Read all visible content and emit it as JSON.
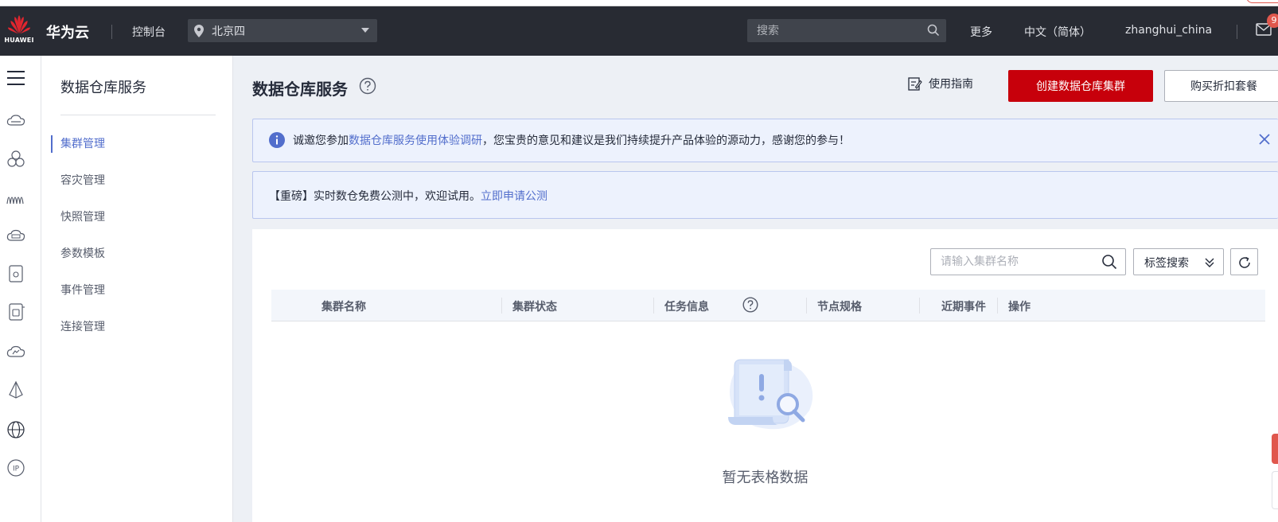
{
  "topbar": {
    "logo_text": "HUAWEI",
    "brand": "华为云",
    "console": "控制台",
    "region": "北京四",
    "search_placeholder": "搜索",
    "more": "更多",
    "language": "中文（简体）",
    "username": "zhanghui_china",
    "mail_badge": "9"
  },
  "rail": {
    "icons": [
      "menu-icon",
      "cloud-server-icon",
      "cluster-icon",
      "waveform-icon",
      "cloud-storage-icon",
      "database-icon",
      "database-sync-icon",
      "cloud-monitor-icon",
      "network-icon",
      "globe-icon",
      "ip-icon"
    ]
  },
  "sidebar": {
    "title": "数据仓库服务",
    "items": [
      {
        "label": "集群管理",
        "active": true
      },
      {
        "label": "容灾管理",
        "active": false
      },
      {
        "label": "快照管理",
        "active": false
      },
      {
        "label": "参数模板",
        "active": false
      },
      {
        "label": "事件管理",
        "active": false
      },
      {
        "label": "连接管理",
        "active": false
      }
    ]
  },
  "main": {
    "title": "数据仓库服务",
    "guide": "使用指南",
    "create_button": "创建数据仓库集群",
    "buy_button": "购买折扣套餐",
    "notice1": {
      "prefix": "诚邀您参加",
      "link": "数据仓库服务使用体验调研",
      "suffix": "，您宝贵的意见和建议是我们持续提升产品体验的源动力，感谢您的参与！"
    },
    "notice2": {
      "prefix": "【重磅】实时数仓免费公测中，欢迎试用。",
      "link": "立即申请公测"
    },
    "table": {
      "search_placeholder": "请输入集群名称",
      "tag_search": "标签搜索",
      "columns": [
        "集群名称",
        "集群状态",
        "任务信息",
        "节点规格",
        "近期事件",
        "操作"
      ],
      "empty_text": "暂无表格数据"
    }
  },
  "colors": {
    "topbar_bg": "#282b33",
    "primary_red": "#c7000b",
    "link_blue": "#526ecc",
    "notice_bg": "#edf2fd",
    "page_bg": "#edf0f5"
  }
}
